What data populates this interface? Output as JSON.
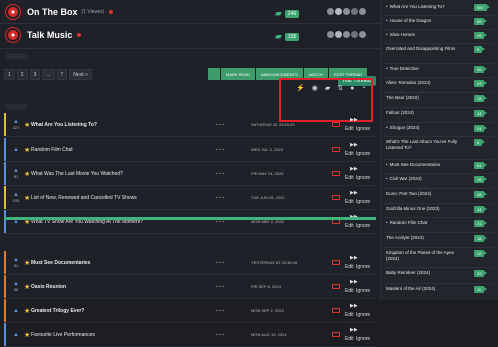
{
  "forums": [
    {
      "name": "On The Box",
      "sub": "(1 Viewer)",
      "count": "246"
    },
    {
      "name": "Talk Music",
      "sub": "",
      "count": "155"
    }
  ],
  "pagination": [
    "1",
    "2",
    "3",
    "...",
    "7",
    "Next »"
  ],
  "action_buttons": [
    "MARK READ",
    "ANNOUNCEMENTS",
    "WATCH",
    "POST THREAD"
  ],
  "your_threads_tooltip": "Your Threads",
  "toolbar_icons": [
    "lightning-icon",
    "eye-icon",
    "chat-icon",
    "sort-icon",
    "user-icon",
    "clock-icon"
  ],
  "threads": [
    {
      "title": "What Are You Listening To?",
      "votes": "227",
      "bold": true,
      "date": "SATURDAY AT 23:59:03",
      "edge": "#d9c13d"
    },
    {
      "title": "Random Film Chat",
      "votes": "",
      "bold": false,
      "date": "WED JUL 3, 2024",
      "edge": "#5b8fd9"
    },
    {
      "title": "What Was The Last Movie You Watched?",
      "votes": "81",
      "bold": false,
      "date": "FRI MAY 24, 2024",
      "edge": "#5b8fd9"
    },
    {
      "title": "List of New, Renewed and Cancelled TV Shows",
      "votes": "105",
      "bold": false,
      "date": "TUE JUN 28, 2022",
      "edge": "#d9c13d"
    },
    {
      "title": "What TV Show Are You Watching At The Moment?",
      "votes": "",
      "bold": false,
      "date": "MON MAY 2, 2022",
      "edge": "#5b8fd9"
    },
    {
      "title": "Must See Documentaries",
      "votes": "51",
      "bold": true,
      "date": "YESTERDAY AT 22:36:49",
      "edge": "#e07a2e"
    },
    {
      "title": "Oasis Reunion",
      "votes": "56",
      "bold": true,
      "date": "FRI SEP 6, 2024",
      "edge": "#e07a2e"
    },
    {
      "title": "Greatest Trilogy Ever?",
      "votes": "",
      "bold": true,
      "date": "MON SEP 2, 2024",
      "edge": "#e07a2e"
    },
    {
      "title": "Favourite Live Performances",
      "votes": "",
      "bold": false,
      "date": "MON AUG 19, 2024",
      "edge": "#5b8fd9"
    }
  ],
  "row_labels": {
    "edit": "Edit",
    "ignore": "Ignore"
  },
  "sidebar": [
    {
      "label": "What Are You Listening To?",
      "badge": "557",
      "bullet": true
    },
    {
      "label": "House of the Dragon",
      "badge": "89",
      "bullet": true
    },
    {
      "label": "Slow Horses",
      "badge": "25",
      "bullet": true
    },
    {
      "label": "Overrated and Disappointing Films",
      "badge": "9",
      "bullet": false
    },
    {
      "label": "True Detective",
      "badge": "36",
      "bullet": true
    },
    {
      "label": "Alien: Romulus (2024)",
      "badge": "23",
      "bullet": false
    },
    {
      "label": "The Bear (2022)",
      "badge": "15",
      "bullet": false
    },
    {
      "label": "Fallout (2024)",
      "badge": "14",
      "bullet": false
    },
    {
      "label": "Shogun (2024)",
      "badge": "24",
      "bullet": true
    },
    {
      "label": "What's The Last Album You've Fully Listened To?",
      "badge": "6",
      "bullet": false
    },
    {
      "label": "Must See Documentaries",
      "badge": "51",
      "bullet": true
    },
    {
      "label": "Civil War (2024)",
      "badge": "15",
      "bullet": true
    },
    {
      "label": "Dune: Part Two (2024)",
      "badge": "45",
      "bullet": false
    },
    {
      "label": "Godzilla Minus One (2023)",
      "badge": "14",
      "bullet": false
    },
    {
      "label": "Random Film Chat",
      "badge": "21",
      "bullet": true
    },
    {
      "label": "The Acolyte (2024)",
      "badge": "18",
      "bullet": false
    },
    {
      "label": "Kingdom of the Planet of the Apes (2024)",
      "badge": "12",
      "bullet": false
    },
    {
      "label": "Baby Reindeer (2024)",
      "badge": "22",
      "bullet": false
    },
    {
      "label": "Masters of the Air (2024)",
      "badge": "11",
      "bullet": false
    }
  ]
}
